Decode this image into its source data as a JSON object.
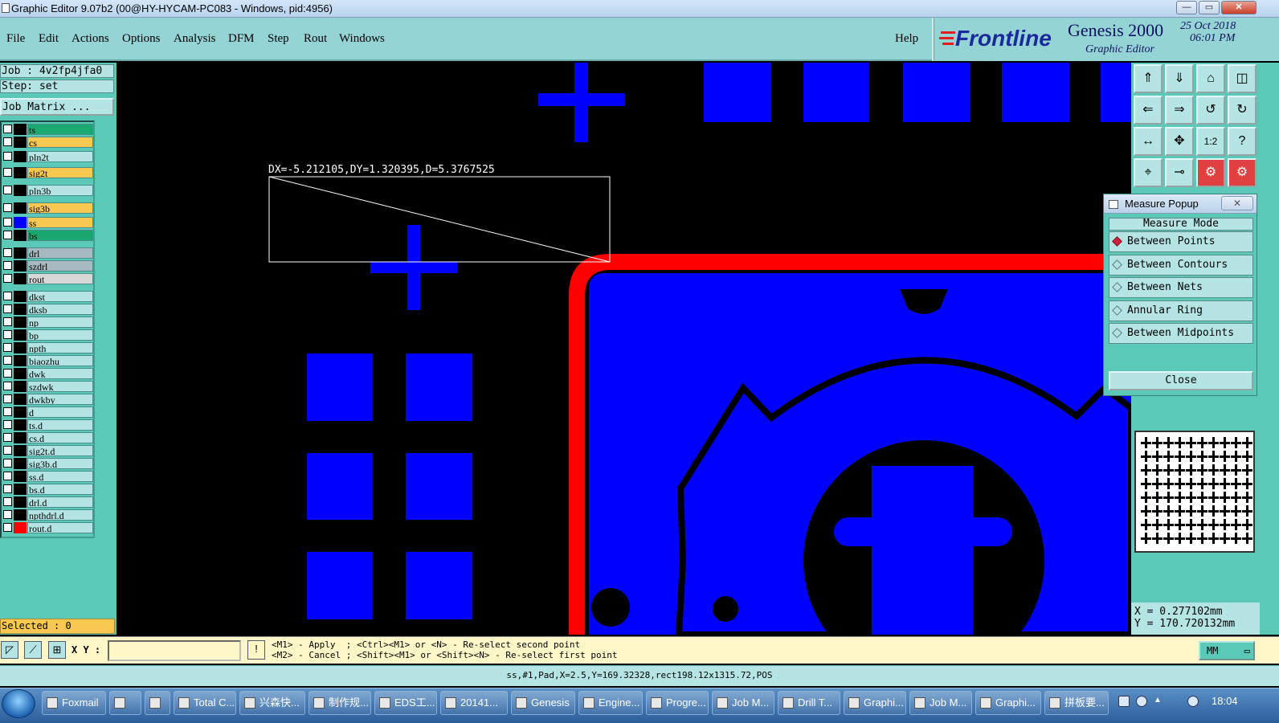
{
  "window": {
    "title": "Graphic Editor 9.07b2 (00@HY-HYCAM-PC083 - Windows, pid:4956)",
    "buttons": [
      "—",
      "▭",
      "✕"
    ]
  },
  "menu": {
    "items": [
      "File",
      "Edit",
      "Actions",
      "Options",
      "Analysis",
      "DFM",
      "Step",
      "Rout",
      "Windows"
    ],
    "help": "Help"
  },
  "brand": {
    "logo": "Frontline",
    "product": "Genesis 2000",
    "subtitle": "Graphic Editor",
    "date": "25 Oct 2018",
    "time": "06:01 PM"
  },
  "job": {
    "job_label": "Job : 4v2fp4jfa0",
    "step_label": "Step: set",
    "matrix_button": "Job Matrix ..."
  },
  "layers": [
    {
      "name": "ts",
      "color": "#1aa870",
      "swatch": "#000000"
    },
    {
      "name": "cs",
      "color": "#f8c850",
      "swatch": "#000000"
    },
    {
      "name": "pln2t",
      "color": "#b4e4e4",
      "swatch": "#000000"
    },
    {
      "name": "sig2t",
      "color": "#f8c850",
      "swatch": "#000000"
    },
    {
      "name": "pln3b",
      "color": "#b4e4e4",
      "swatch": "#000000"
    },
    {
      "name": "sig3b",
      "color": "#f8c850",
      "swatch": "#000000"
    },
    {
      "name": "ss",
      "color": "#f8c850",
      "swatch": "#0000ff"
    },
    {
      "name": "bs",
      "color": "#1aa870",
      "swatch": "#000000"
    },
    {
      "name": "drl",
      "color": "#a8b8c0",
      "swatch": "#000000"
    },
    {
      "name": "szdrl",
      "color": "#a8b8c0",
      "swatch": "#000000"
    },
    {
      "name": "rout",
      "color": "#d8d8d8",
      "swatch": "#000000"
    },
    {
      "name": "dkst",
      "color": "#b4e4e4",
      "swatch": "#000000"
    },
    {
      "name": "dksb",
      "color": "#b4e4e4",
      "swatch": "#000000"
    },
    {
      "name": "np",
      "color": "#b4e4e4",
      "swatch": "#000000"
    },
    {
      "name": "bp",
      "color": "#b4e4e4",
      "swatch": "#000000"
    },
    {
      "name": "npth",
      "color": "#b4e4e4",
      "swatch": "#000000"
    },
    {
      "name": "biaozhu",
      "color": "#b4e4e4",
      "swatch": "#000000"
    },
    {
      "name": "dwk",
      "color": "#b4e4e4",
      "swatch": "#000000"
    },
    {
      "name": "szdwk",
      "color": "#b4e4e4",
      "swatch": "#000000"
    },
    {
      "name": "dwkby",
      "color": "#b4e4e4",
      "swatch": "#000000"
    },
    {
      "name": "d",
      "color": "#b4e4e4",
      "swatch": "#000000"
    },
    {
      "name": "ts.d",
      "color": "#b4e4e4",
      "swatch": "#000000"
    },
    {
      "name": "cs.d",
      "color": "#b4e4e4",
      "swatch": "#000000"
    },
    {
      "name": "sig2t.d",
      "color": "#b4e4e4",
      "swatch": "#000000"
    },
    {
      "name": "sig3b.d",
      "color": "#b4e4e4",
      "swatch": "#000000"
    },
    {
      "name": "ss.d",
      "color": "#b4e4e4",
      "swatch": "#000000"
    },
    {
      "name": "bs.d",
      "color": "#b4e4e4",
      "swatch": "#000000"
    },
    {
      "name": "drl.d",
      "color": "#b4e4e4",
      "swatch": "#000000"
    },
    {
      "name": "npthdrl.d",
      "color": "#b4e4e4",
      "swatch": "#000000"
    },
    {
      "name": "rout.d",
      "color": "#b4e4e4",
      "swatch": "#ff0000"
    }
  ],
  "selected": "Selected : 0",
  "canvas": {
    "measure_readout": "DX=-5.212105,DY=1.320395,D=5.3767525",
    "pad_color": "#0000ff",
    "outline_color": "#ff0000"
  },
  "toolbar_icons": [
    "zoom-home-icon",
    "zoom-down-icon",
    "home-icon",
    "split-view-icon",
    "pan-left-icon",
    "pan-right-icon",
    "undo-view-icon",
    "redraw-icon",
    "fit-width-icon",
    "fit-all-icon",
    "scale-1-2-icon",
    "help-icon",
    "ruler-icon",
    "measure-icon",
    "snap-on-icon",
    "snap-off-icon"
  ],
  "toolbar_glyphs": [
    "⇑",
    "⇓",
    "⌂",
    "◫",
    "⇐",
    "⇒",
    "↺",
    "↻",
    "↔",
    "✥",
    "1:2",
    "?",
    "⌖",
    "⊸",
    "⚙",
    "⚙"
  ],
  "measure_popup": {
    "title": "Measure Popup",
    "close_x": "✕",
    "mode_label": "Measure Mode",
    "options": [
      "Between Points",
      "Between Contours",
      "Between Nets",
      "Annular Ring",
      "Between Midpoints"
    ],
    "selected_index": 0,
    "close_button": "Close"
  },
  "coords": {
    "x": "X = 0.277102mm",
    "y": "Y = 170.720132mm"
  },
  "command": {
    "xy_label": "X Y :",
    "xy_value": "",
    "info_glyph": "!",
    "hint1": "<M1> - Apply  ; <Ctrl><M1> or <N> - Re-select second point",
    "hint2": "<M2> - Cancel ; <Shift><M1> or <Shift><N> - Re-select first point",
    "unit": "MM"
  },
  "status": "ss,#1,Pad,X=2.5,Y=169.32328,rect198.12x1315.72,POS",
  "taskbar": {
    "items": [
      "Foxmail",
      "",
      "",
      "Total C...",
      "兴森快...",
      "制作规...",
      "EDS工...",
      "20141...",
      "Genesis",
      "Engine...",
      "Progre...",
      "Job M...",
      "Drill T...",
      "Graphi...",
      "Job M...",
      "Graphi...",
      "拼板要..."
    ],
    "clock": "18:04"
  }
}
